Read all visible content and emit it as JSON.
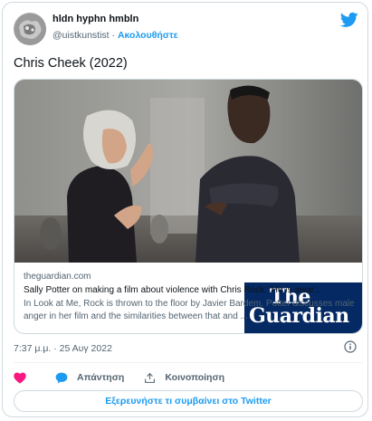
{
  "user": {
    "display_name": "hldn hyphn hmbln",
    "handle": "@uistkunstist",
    "separator": "·",
    "follow_label": "Ακολουθήστε"
  },
  "tweet": {
    "text": "Chris Cheek (2022)",
    "timestamp": "7:37 μ.μ. · 25 Αυγ 2022"
  },
  "link_card": {
    "domain": "theguardian.com",
    "headline": "Sally Potter on making a film about violence with Chris Rock: 'He is awar...",
    "description": "In Look at Me, Rock is thrown to the floor by Javier Bardem. Potter discusses male anger in her film and the similarities between that and ...",
    "brand_line1": "The",
    "brand_line2": "Guardian"
  },
  "actions": {
    "like_icon": "heart-icon",
    "reply_label": "Απάντηση",
    "share_label": "Κοινοποίηση"
  },
  "footer": {
    "explore_label": "Εξερευνήστε τι συμβαίνει στο Twitter"
  },
  "colors": {
    "accent": "#1d9bf0",
    "like": "#f91880",
    "guardian_blue": "#052962"
  }
}
